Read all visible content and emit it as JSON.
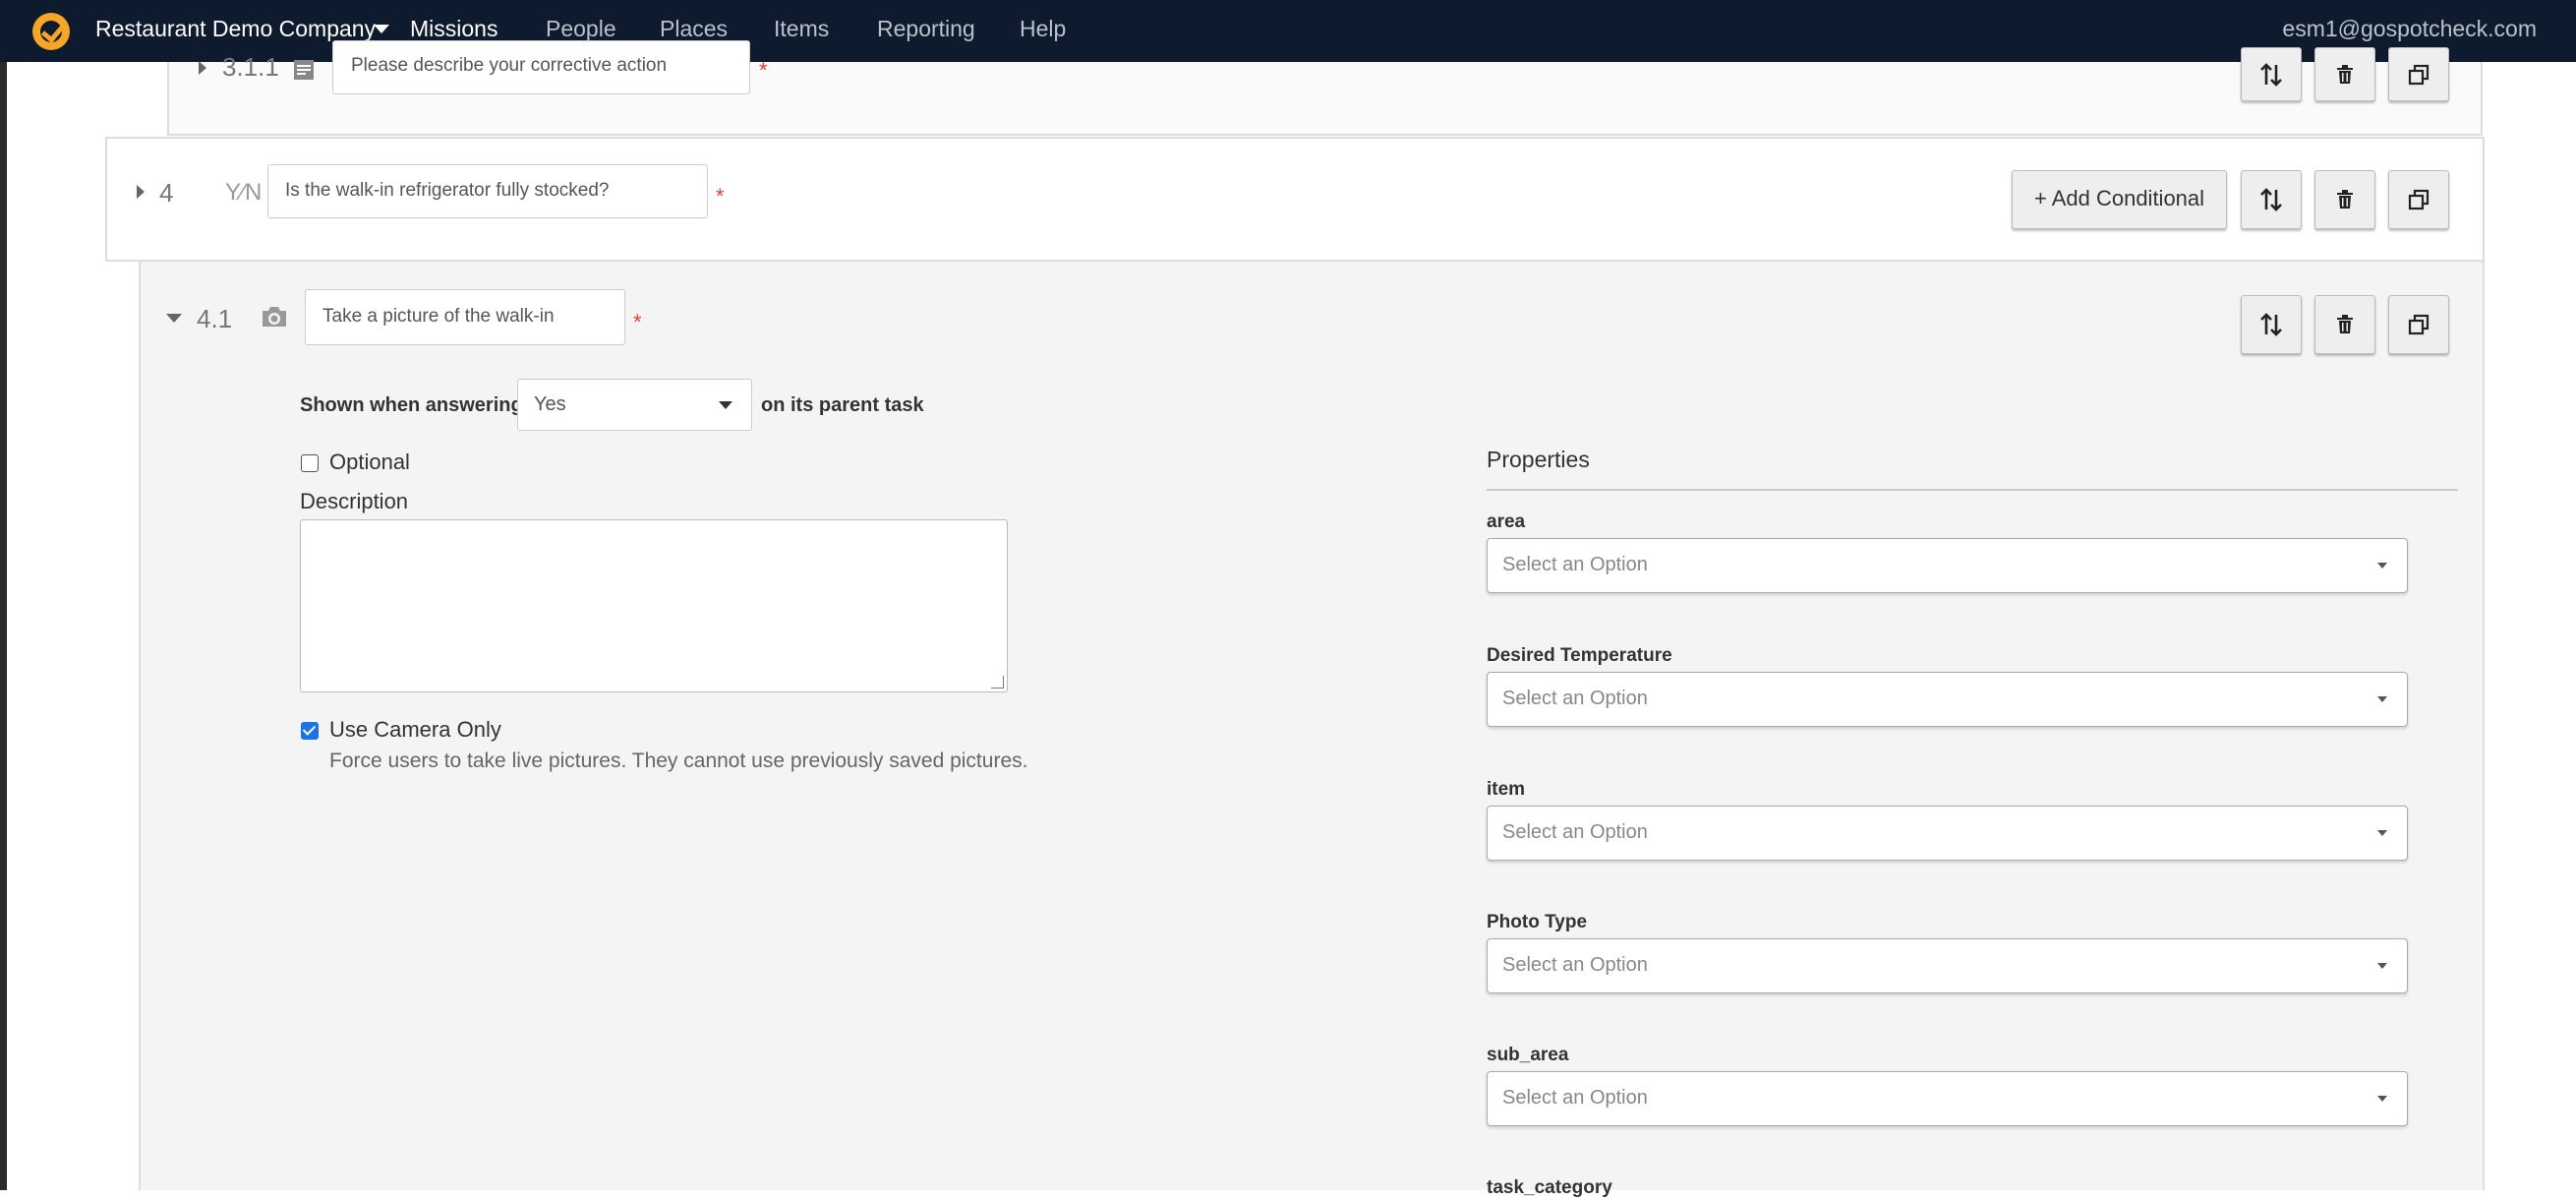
{
  "nav": {
    "company": "Restaurant Demo Company",
    "items": [
      {
        "label": "Missions"
      },
      {
        "label": "People"
      },
      {
        "label": "Places"
      },
      {
        "label": "Items"
      },
      {
        "label": "Reporting"
      },
      {
        "label": "Help"
      }
    ],
    "active": "Missions",
    "user_email": "esm1@gospotcheck.com",
    "accent_color": "#2196f3",
    "logo_color": "#f5a623"
  },
  "tasks": {
    "t311": {
      "number": "3.1.1",
      "type_icon": "text-lines-icon",
      "prompt": "Please describe your corrective action"
    },
    "t4": {
      "number": "4",
      "type_icon": "yes-no-icon",
      "type_glyph": "Y⁄N",
      "prompt": "Is the walk-in refrigerator fully stocked?",
      "add_conditional_label": "+ Add Conditional"
    },
    "t41": {
      "number": "4.1",
      "type_icon": "camera-icon",
      "prompt": "Take a picture of the walk-in"
    }
  },
  "required_marker": "*",
  "condition": {
    "prefix": "Shown when answering",
    "value": "Yes",
    "suffix": "on its parent task"
  },
  "optional": {
    "label": "Optional",
    "checked": false
  },
  "description": {
    "label": "Description",
    "value": ""
  },
  "camera_only": {
    "label": "Use Camera Only",
    "checked": true,
    "help": "Force users to take live pictures. They cannot use previously saved pictures."
  },
  "properties": {
    "title": "Properties",
    "placeholder": "Select an Option",
    "fields": [
      {
        "label": "area"
      },
      {
        "label": "Desired Temperature"
      },
      {
        "label": "item"
      },
      {
        "label": "Photo Type"
      },
      {
        "label": "sub_area"
      },
      {
        "label": "task_category"
      }
    ]
  }
}
